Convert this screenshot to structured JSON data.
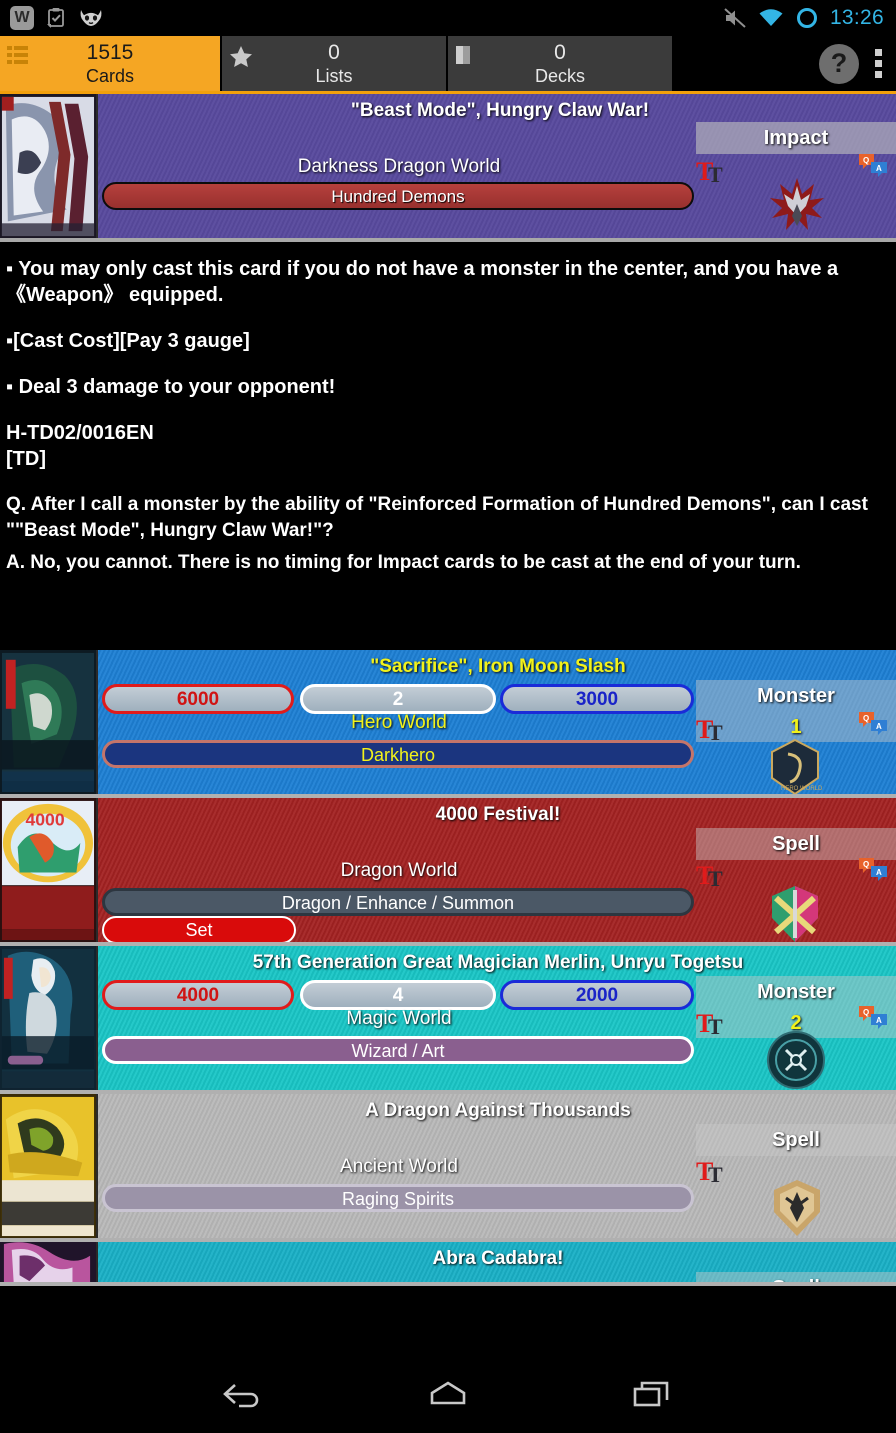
{
  "statusbar": {
    "icons": [
      "w-app-icon",
      "clipboard-check-icon",
      "cyanogenmod-robot-icon"
    ],
    "mute_icon": "mute-icon",
    "wifi_icon": "wifi-icon",
    "battery_icon": "battery-circle-icon",
    "clock": "13:26"
  },
  "tabs": [
    {
      "name": "cards",
      "count": "1515",
      "label": "Cards",
      "icon": "list-lines-icon",
      "active": true
    },
    {
      "name": "lists",
      "count": "0",
      "label": "Lists",
      "icon": "star-icon",
      "active": false
    },
    {
      "name": "decks",
      "count": "0",
      "label": "Decks",
      "icon": "deck-card-icon",
      "active": false
    }
  ],
  "toolbar": {
    "help_label": "?",
    "help_icon": "help-icon",
    "overflow_icon": "overflow-menu-icon"
  },
  "detail": {
    "title": "\"Beast Mode\", Hungry Claw War!",
    "world": "Darkness Dragon World",
    "attribute": "Hundred Demons",
    "card_type": "Impact",
    "thumb_name": "card-thumbnail",
    "text_icon": "text-size-icon",
    "qa_icon": "qa-bubble-icon",
    "world_emblem": "darkness-dragon-world-emblem",
    "bg_color": "#584a9e",
    "attr_color": "#b6403d"
  },
  "card_text": {
    "lines": [
      "▪ You may only cast this card if you do not have a monster in the center, and you have a 《Weapon》 equipped.",
      "▪[Cast Cost][Pay 3 gauge]",
      "▪ Deal 3 damage to your opponent!"
    ],
    "card_number": "H-TD02/0016EN",
    "rarity": "[TD]",
    "qa_question": "Q. After I call a monster by the ability of \"Reinforced Formation of Hundred Demons\", can I cast \"\"Beast Mode\", Hungry Claw War!\"?",
    "qa_answer": "A. No, you cannot. There is no timing for Impact cards to be cast at the end of your turn."
  },
  "card_list": [
    {
      "title": "\"Sacrifice\", Iron Moon Slash",
      "title_color": "#f2f21a",
      "world": "Hero World",
      "world_color": "#f2f21a",
      "attribute": "Darkhero",
      "attribute_color": "#f2f21a",
      "attribute_bg": "#1b357f",
      "attribute_border": "#c4756a",
      "power": "6000",
      "size": "2",
      "defense": "3000",
      "card_type": "Monster",
      "type_number": "1",
      "type_number_color": "#f2f21a",
      "set_label": "",
      "bg_color": "#1d7fd4",
      "thumb_name": "card-thumbnail",
      "world_emblem": "hero-world-emblem",
      "text_icon": "text-size-icon",
      "qa_icon": "qa-bubble-icon"
    },
    {
      "title": "4000 Festival!",
      "title_color": "#ffffff",
      "world": "Dragon World",
      "world_color": "#ffffff",
      "attribute": "Dragon / Enhance / Summon",
      "attribute_color": "#ffffff",
      "attribute_bg": "#4b5866",
      "attribute_border": "#2d3640",
      "power": "",
      "size": "",
      "defense": "",
      "card_type": "Spell",
      "type_number": "",
      "type_number_color": "#ffffff",
      "set_label": "Set",
      "bg_color": "#a32222",
      "thumb_name": "card-thumbnail",
      "world_emblem": "dragon-world-emblem",
      "text_icon": "text-size-icon",
      "qa_icon": "qa-bubble-icon"
    },
    {
      "title": "57th Generation Great Magician Merlin, Unryu Togetsu",
      "title_color": "#ffffff",
      "world": "Magic World",
      "world_color": "#ffffff",
      "attribute": "Wizard / Art",
      "attribute_color": "#ffffff",
      "attribute_bg": "#8a5f8f",
      "attribute_border": "#ffffff",
      "power": "4000",
      "size": "4",
      "defense": "2000",
      "card_type": "Monster",
      "type_number": "2",
      "type_number_color": "#f2f21a",
      "set_label": "",
      "bg_color": "#19c6c6",
      "thumb_name": "card-thumbnail",
      "world_emblem": "magic-world-emblem",
      "text_icon": "text-size-icon",
      "qa_icon": "qa-bubble-icon"
    },
    {
      "title": "A Dragon Against Thousands",
      "title_color": "#ffffff",
      "world": "Ancient World",
      "world_color": "#ffffff",
      "attribute": "Raging Spirits",
      "attribute_color": "#ffffff",
      "attribute_bg": "#9b93a8",
      "attribute_border": "#c9c4d2",
      "power": "",
      "size": "",
      "defense": "",
      "card_type": "Spell",
      "type_number": "",
      "type_number_color": "#ffffff",
      "set_label": "",
      "bg_color": "#b9b9b9",
      "thumb_name": "card-thumbnail",
      "world_emblem": "ancient-world-emblem",
      "text_icon": "text-size-icon",
      "qa_icon": "qa-bubble-icon"
    },
    {
      "title": "Abra Cadabra!",
      "title_color": "#ffffff",
      "world": "",
      "world_color": "#ffffff",
      "attribute": "",
      "attribute_color": "#ffffff",
      "attribute_bg": "#8a5f8f",
      "attribute_border": "#ffffff",
      "power": "",
      "size": "",
      "defense": "",
      "card_type": "Spell",
      "type_number": "",
      "type_number_color": "#ffffff",
      "set_label": "",
      "bg_color": "#19b0c6",
      "thumb_name": "card-thumbnail",
      "world_emblem": "magic-world-emblem",
      "text_icon": "text-size-icon",
      "qa_icon": "qa-bubble-icon"
    }
  ],
  "navbar": {
    "back_icon": "back-icon",
    "home_icon": "home-icon",
    "recents_icon": "recents-icon"
  }
}
